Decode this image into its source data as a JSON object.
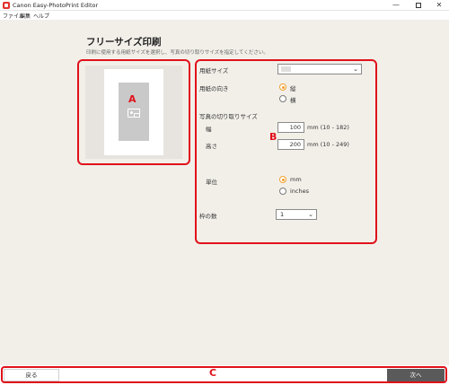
{
  "window": {
    "title": "Canon Easy-PhotoPrint Editor",
    "minimize_glyph": "—",
    "close_glyph": "✕"
  },
  "menu": {
    "file": "ファイル",
    "edit": "編集",
    "help": "ヘルプ"
  },
  "page": {
    "title": "フリーサイズ印刷",
    "description": "印刷に使用する用紙サイズを選択し、写真の切り取りサイズを指定してください。"
  },
  "settings": {
    "paper_size_label": "用紙サイズ",
    "paper_size_value": "",
    "orientation_label": "用紙の向き",
    "orientation_options": [
      "縦",
      "横"
    ],
    "orientation_selected": "縦",
    "crop_size_label": "写真の切り取りサイズ",
    "width_label": "幅",
    "width_value": "100",
    "width_range": "mm (10 - 182)",
    "height_label": "高さ",
    "height_value": "200",
    "height_range": "mm (10 - 249)",
    "unit_label": "単位",
    "unit_options": [
      "mm",
      "inches"
    ],
    "unit_selected": "mm",
    "frames_label": "枠の数",
    "frames_value": "1"
  },
  "markers": {
    "a": "A",
    "b": "B",
    "c": "C"
  },
  "footer": {
    "back_label": "戻る",
    "next_label": "次へ"
  },
  "colors": {
    "callout": "#e0111a",
    "radio_accent": "#f0a030",
    "content_bg": "#f2efe9",
    "next_button_bg": "#5a5a5a"
  }
}
